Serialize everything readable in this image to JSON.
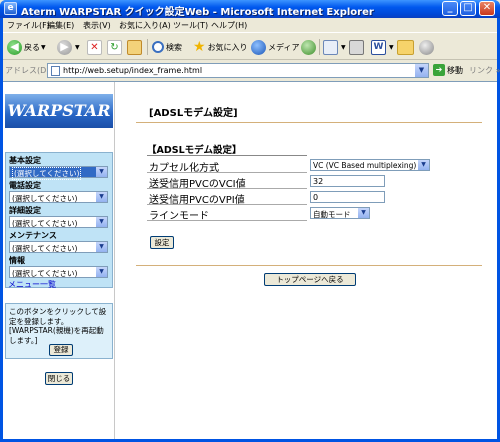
{
  "window": {
    "title": "Aterm WARPSTAR クイック設定Web - Microsoft Internet Explorer",
    "min": "_",
    "max": "□",
    "close": "✕"
  },
  "menubar": [
    "ファイル(F)",
    "編集(E)",
    "表示(V)",
    "お気に入り(A)",
    "ツール(T)",
    "ヘルプ(H)"
  ],
  "toolbar": {
    "back": "戻る",
    "search": "検索",
    "favorites": "お気に入り",
    "media": "メディア"
  },
  "address": {
    "label": "アドレス(D)",
    "url": "http://web.setup/index_frame.html",
    "go": "移動",
    "links": "リンク »"
  },
  "sidebar": {
    "logo": "WARPSTAR",
    "groups": [
      {
        "label": "基本設定",
        "value": "(選択してください)"
      },
      {
        "label": "電話設定",
        "value": "(選択してください)"
      },
      {
        "label": "詳細設定",
        "value": "(選択してください)"
      },
      {
        "label": "メンテナンス",
        "value": "(選択してください)"
      },
      {
        "label": "情報",
        "value": "(選択してください)"
      }
    ],
    "menu_list": "メニュー一覧",
    "help_text": "このボタンをクリックして設定を登録します。[WARPSTAR(親機)を再起動します。]",
    "register": "登録",
    "close": "閉じる"
  },
  "main": {
    "page_title": "[ADSLモデム設定]",
    "section_title": "【ADSLモデム設定】",
    "rows": [
      {
        "label": "カプセル化方式",
        "value": "VC (VC Based multiplexing)"
      },
      {
        "label": "送受信用PVCのVCI値",
        "value": "32"
      },
      {
        "label": "送受信用PVCのVPI値",
        "value": "0"
      },
      {
        "label": "ラインモード",
        "value": "自動モード"
      }
    ],
    "set_button": "設定",
    "top_button": "トップページへ戻る"
  }
}
